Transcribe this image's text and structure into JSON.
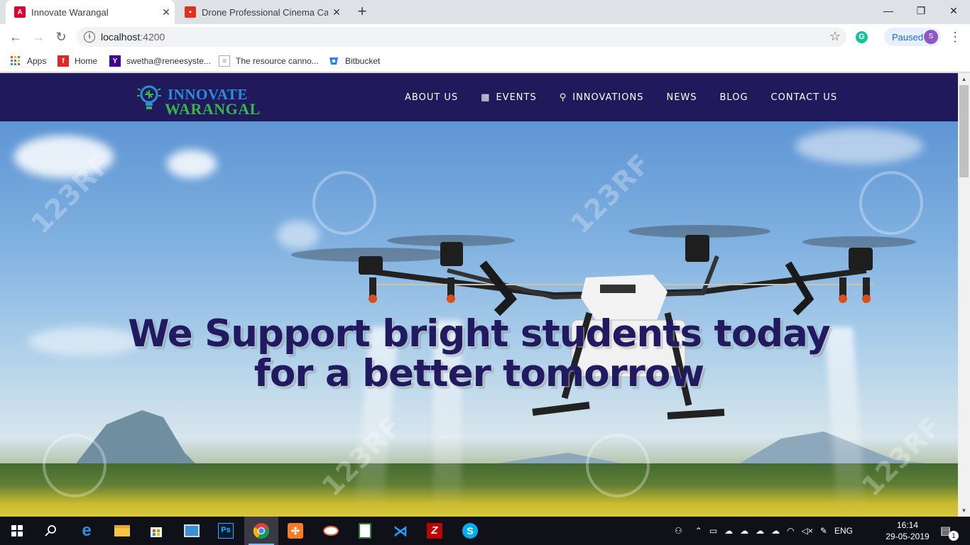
{
  "browser": {
    "tabs": [
      {
        "title": "Innovate Warangal",
        "active": true
      },
      {
        "title": "Drone Professional Cinema Came",
        "active": false
      }
    ],
    "url_host": "localhost",
    "url_port": ":4200",
    "paused_label": "Paused",
    "profile_initial": "S",
    "grammarly_letter": "G"
  },
  "bookmarks": [
    {
      "label": "Apps",
      "icon": "apps-grid-icon"
    },
    {
      "label": "Home",
      "icon": "flipboard-icon"
    },
    {
      "label": "swetha@reneesyste...",
      "icon": "yahoo-icon"
    },
    {
      "label": "The resource canno...",
      "icon": "page-icon"
    },
    {
      "label": "Bitbucket",
      "icon": "bitbucket-icon"
    }
  ],
  "site": {
    "logo_line1": "INNOVATE",
    "logo_line2": "WARANGAL",
    "nav": [
      {
        "label": "ABOUT US",
        "icon": ""
      },
      {
        "label": "EVENTS",
        "icon": "calendar-icon"
      },
      {
        "label": "INNOVATIONS",
        "icon": "map-pin-icon"
      },
      {
        "label": "NEWS",
        "icon": ""
      },
      {
        "label": "BLOG",
        "icon": ""
      },
      {
        "label": "CONTACT US",
        "icon": ""
      }
    ],
    "headline_line1": "We Support bright students today",
    "headline_line2": "for a better tomorrow",
    "watermark": "123RF"
  },
  "taskbar": {
    "time": "16:14",
    "date": "29-05-2019",
    "language": "ENG",
    "notification_count": "1"
  },
  "colors": {
    "nav_bg": "#20195c",
    "headline": "#221a60",
    "logo_blue": "#2a8fd8",
    "logo_green": "#3ab54a"
  }
}
